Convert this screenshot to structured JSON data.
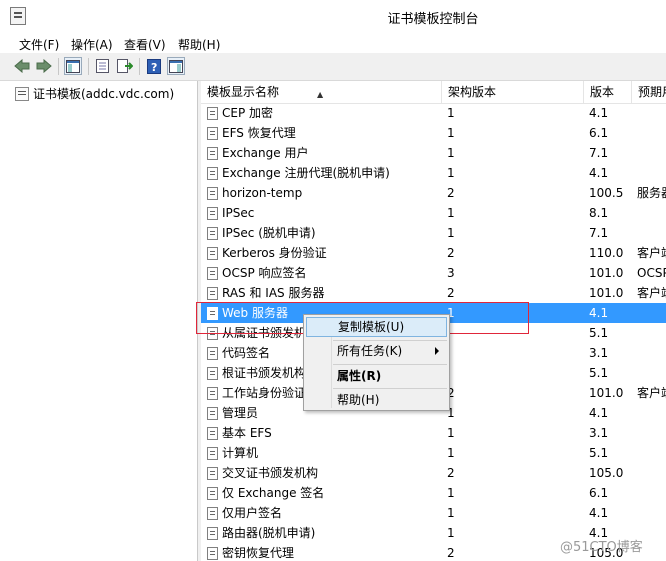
{
  "window": {
    "title": "证书模板控制台"
  },
  "menu": [
    "文件(F)",
    "操作(A)",
    "查看(V)",
    "帮助(H)"
  ],
  "toolbar": {
    "icons": [
      "back-arrow-icon",
      "forward-arrow-icon",
      "console-tree-icon",
      "export-list-icon",
      "properties-icon",
      "help-icon",
      "action-pane-icon"
    ]
  },
  "tree": {
    "item": "证书模板(addc.vdc.com)"
  },
  "table": {
    "columns": [
      "模板显示名称",
      "架构版本",
      "版本",
      "预期用"
    ],
    "rows": [
      {
        "name": "CEP 加密",
        "schema": "1",
        "version": "4.1",
        "purpose": ""
      },
      {
        "name": "EFS 恢复代理",
        "schema": "1",
        "version": "6.1",
        "purpose": ""
      },
      {
        "name": "Exchange 用户",
        "schema": "1",
        "version": "7.1",
        "purpose": ""
      },
      {
        "name": "Exchange 注册代理(脱机申请)",
        "schema": "1",
        "version": "4.1",
        "purpose": ""
      },
      {
        "name": "horizon-temp",
        "schema": "2",
        "version": "100.5",
        "purpose": "服务器"
      },
      {
        "name": "IPSec",
        "schema": "1",
        "version": "8.1",
        "purpose": ""
      },
      {
        "name": "IPSec (脱机申请)",
        "schema": "1",
        "version": "7.1",
        "purpose": ""
      },
      {
        "name": "Kerberos 身份验证",
        "schema": "2",
        "version": "110.0",
        "purpose": "客户端"
      },
      {
        "name": "OCSP 响应签名",
        "schema": "3",
        "version": "101.0",
        "purpose": "OCSP"
      },
      {
        "name": "RAS 和 IAS 服务器",
        "schema": "2",
        "version": "101.0",
        "purpose": "客户端"
      },
      {
        "name": "Web 服务器",
        "schema": "1",
        "version": "4.1",
        "purpose": ""
      },
      {
        "name": "从属证书颁发机构",
        "schema": "",
        "version": "5.1",
        "purpose": ""
      },
      {
        "name": "代码签名",
        "schema": "",
        "version": "3.1",
        "purpose": ""
      },
      {
        "name": "根证书颁发机构",
        "schema": "",
        "version": "5.1",
        "purpose": ""
      },
      {
        "name": "工作站身份验证",
        "schema": "2",
        "version": "101.0",
        "purpose": "客户端"
      },
      {
        "name": "管理员",
        "schema": "1",
        "version": "4.1",
        "purpose": ""
      },
      {
        "name": "基本 EFS",
        "schema": "1",
        "version": "3.1",
        "purpose": ""
      },
      {
        "name": "计算机",
        "schema": "1",
        "version": "5.1",
        "purpose": ""
      },
      {
        "name": "交叉证书颁发机构",
        "schema": "2",
        "version": "105.0",
        "purpose": ""
      },
      {
        "name": "仅 Exchange 签名",
        "schema": "1",
        "version": "6.1",
        "purpose": ""
      },
      {
        "name": "仅用户签名",
        "schema": "1",
        "version": "4.1",
        "purpose": ""
      },
      {
        "name": "路由器(脱机申请)",
        "schema": "1",
        "version": "4.1",
        "purpose": ""
      },
      {
        "name": "密钥恢复代理",
        "schema": "2",
        "version": "105.0",
        "purpose": ""
      }
    ],
    "selected_index": 10
  },
  "context_menu": {
    "items": [
      "复制模板(U)",
      "所有任务(K)",
      "属性(R)",
      "帮助(H)"
    ]
  },
  "watermark": "@51CTO博客"
}
